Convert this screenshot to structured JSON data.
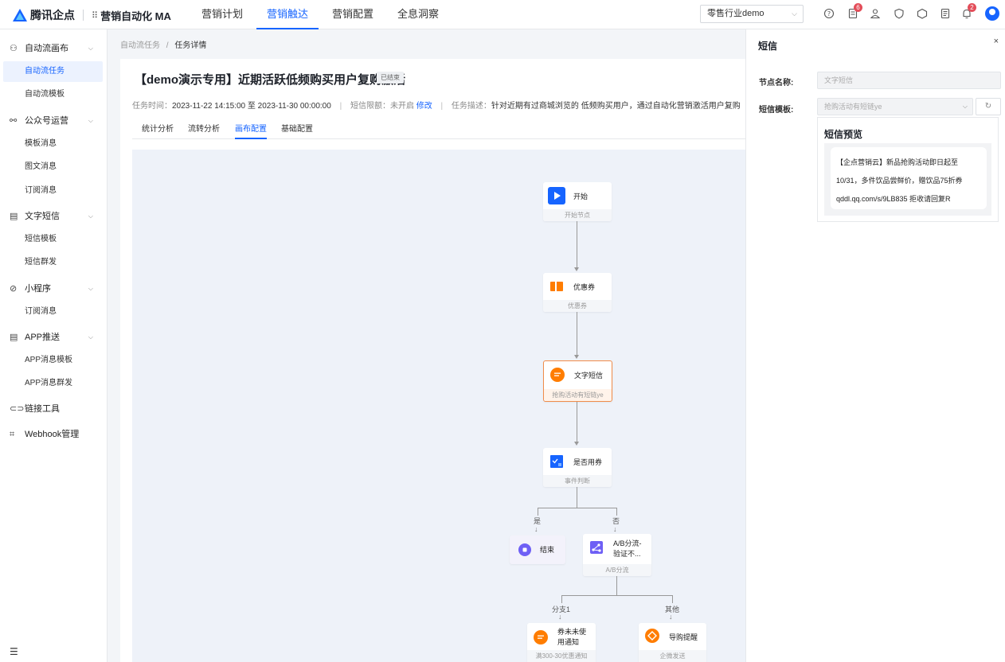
{
  "header": {
    "logo_text": "腾讯企点",
    "app_name": "营销自动化 MA",
    "nav": [
      "营销计划",
      "营销触达",
      "营销配置",
      "全息洞察"
    ],
    "active_nav": "营销触达",
    "org_select": "零售行业demo",
    "badges": {
      "tasks": "6",
      "notifications": "2"
    }
  },
  "sidebar": {
    "groups": [
      {
        "label": "自动流画布",
        "icon": "flow-icon",
        "items": [
          "自动流任务",
          "自动流模板"
        ]
      },
      {
        "label": "公众号运营",
        "icon": "wechat-icon",
        "items": [
          "模板消息",
          "图文消息",
          "订阅消息"
        ]
      },
      {
        "label": "文字短信",
        "icon": "sms-icon",
        "items": [
          "短信模板",
          "短信群发"
        ]
      },
      {
        "label": "小程序",
        "icon": "miniprogram-icon",
        "items": [
          "订阅消息"
        ]
      },
      {
        "label": "APP推送",
        "icon": "app-push-icon",
        "items": [
          "APP消息模板",
          "APP消息群发"
        ]
      },
      {
        "label": "链接工具",
        "icon": "link-icon",
        "items": []
      },
      {
        "label": "Webhook管理",
        "icon": "webhook-icon",
        "items": []
      }
    ],
    "active_item": "自动流任务"
  },
  "breadcrumb": {
    "parent": "自动流任务",
    "separator": "/",
    "current": "任务详情"
  },
  "task": {
    "title": "【demo演示专用】近期活跃低频购买用户复购激活",
    "status": "已结束",
    "time_label": "任务时间：",
    "time_value": "2023-11-22 14:15:00 至 2023-11-30 00:00:00",
    "sms_limit_label": "短信限额：",
    "sms_limit_value": "未开启",
    "sms_limit_link": "修改",
    "desc_label": "任务描述：",
    "desc_value": "针对近期有过商城浏览的 低频购买用户，通过自动化营销激活用户复购"
  },
  "tabs": [
    "统计分析",
    "流转分析",
    "画布配置",
    "基础配置"
  ],
  "active_tab": "画布配置",
  "flow": {
    "nodes": {
      "start": {
        "label": "开始",
        "sub": "开始节点",
        "color": "#1664ff"
      },
      "coupon": {
        "label": "优惠券",
        "sub": "优惠券",
        "color": "#ff7d00"
      },
      "sms": {
        "label": "文字短信",
        "sub": "抢购活动有短链ye",
        "color": "#ff7d00"
      },
      "judge": {
        "label": "是否用券",
        "sub": "事件判断",
        "color": "#1664ff"
      },
      "end": {
        "label": "结束",
        "color": "#6e5ff5"
      },
      "ab": {
        "label_line1": "A/B分流-",
        "label_line2": "验证不...",
        "sub": "A/B分流",
        "color": "#6e5ff5"
      },
      "notice": {
        "label_line1": "券未未使",
        "label_line2": "用通知",
        "sub": "满300-30优惠通知",
        "color": "#ff7d00"
      },
      "guide": {
        "label": "导购提醒",
        "sub": "企微发送",
        "color": "#ff7d00"
      }
    },
    "branch_yes": "是",
    "branch_no": "否",
    "branch_1": "分支1",
    "branch_other": "其他"
  },
  "drawer": {
    "title": "短信",
    "node_name_label": "节点名称:",
    "node_name_value": "文字短信",
    "template_label": "短信模板:",
    "template_value": "抢购活动有短链ye",
    "preview_title": "短信预览",
    "preview_line1": "【企点营销云】新品抢购活动即日起至",
    "preview_line2": "10/31，多件饮品尝鲜价，赠饮品75折券",
    "preview_line3": "qddl.qq.com/s/9LB835 拒收请回复R"
  }
}
